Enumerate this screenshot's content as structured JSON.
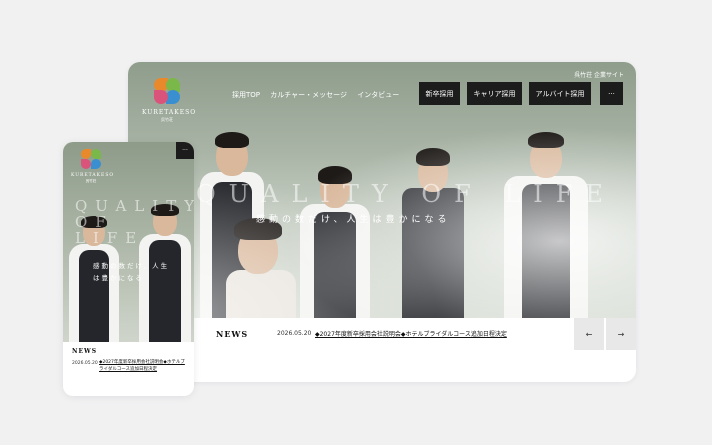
{
  "desktop": {
    "logo": {
      "name": "KURETAKESO",
      "sub": "呉竹荘"
    },
    "nav": [
      "採用TOP",
      "カルチャー・メッセージ",
      "インタビュー"
    ],
    "buttons": {
      "new_grad": "新卒採用",
      "career": "キャリア採用",
      "part_time": "アルバイト採用",
      "menu": "···"
    },
    "corporate_link": "呉竹荘 企業サイト",
    "hero": {
      "headline": "QUALITY OF LIFE",
      "subcopy": "感動の数だけ、人生は豊かになる"
    },
    "news": {
      "label": "NEWS",
      "date": "2026.05.20",
      "text": "◆2027年度新卒採用会社説明会◆ホテルブライダルコース追加日程決定"
    },
    "arrows": {
      "prev": "←",
      "next": "→"
    }
  },
  "mobile": {
    "logo": {
      "name": "KURETAKESO",
      "sub": "呉竹荘"
    },
    "menu": "···",
    "hero": {
      "headline": "QUALITY OF LIFE",
      "subcopy": "感動の数だけ、人生は豊かになる"
    },
    "news": {
      "label": "NEWS",
      "date": "2026.05.20",
      "text": "◆2027年度新卒採用会社説明会◆ホテルブライダルコース追加日程決定"
    }
  },
  "colors": {
    "logo_green": "#7bb84a",
    "logo_blue": "#3a8fd0",
    "logo_orange": "#e8892c",
    "logo_pink": "#d9537a",
    "dark_button": "#1c1c1c"
  }
}
